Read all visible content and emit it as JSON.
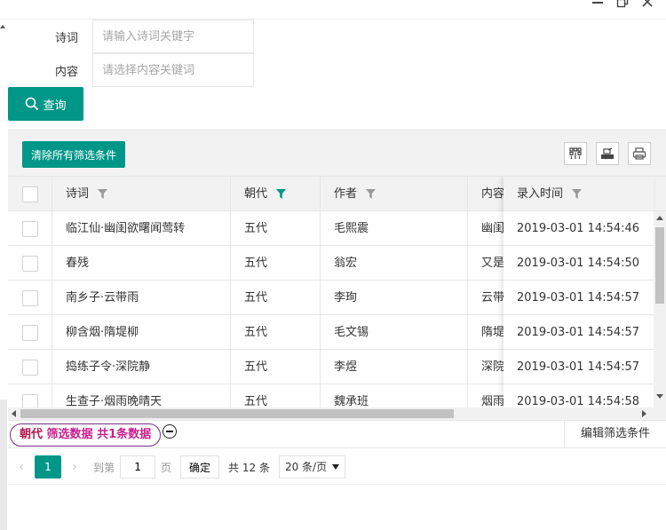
{
  "form": {
    "poem_label": "诗词",
    "poem_placeholder": "请输入诗词关键字",
    "content_label": "内容",
    "content_placeholder": "请选择内容关键词",
    "query_label": "查询"
  },
  "toolbar": {
    "clear_label": "清除所有筛选条件"
  },
  "columns": {
    "poem": "诗词",
    "dynasty": "朝代",
    "author": "作者",
    "content": "内容",
    "time": "录入时间"
  },
  "rows": [
    {
      "poem": "临江仙·幽闺欲曙闻莺转",
      "dynasty": "五代",
      "author": "毛熙震",
      "content": "幽闺",
      "time": "2019-03-01 14:54:46"
    },
    {
      "poem": "春残",
      "dynasty": "五代",
      "author": "翁宏",
      "content": "又是",
      "time": "2019-03-01 14:54:50"
    },
    {
      "poem": "南乡子·云带雨",
      "dynasty": "五代",
      "author": "李珣",
      "content": "云带",
      "time": "2019-03-01 14:54:57"
    },
    {
      "poem": "柳含烟·隋堤柳",
      "dynasty": "五代",
      "author": "毛文锡",
      "content": "隋堤",
      "time": "2019-03-01 14:54:57"
    },
    {
      "poem": "捣练子令·深院静",
      "dynasty": "五代",
      "author": "李煜",
      "content": "深院",
      "time": "2019-03-01 14:54:57"
    },
    {
      "poem": "生查子·烟雨晚晴天",
      "dynasty": "五代",
      "author": "魏承班",
      "content": "烟雨",
      "time": "2019-03-01 14:54:58"
    }
  ],
  "filterbar": {
    "field": "朝代",
    "summary": " 筛选数据 共1条数据",
    "edit_label": "编辑筛选条件"
  },
  "pager": {
    "current_page": "1",
    "goto_label": "到第",
    "goto_value": "1",
    "page_unit": "页",
    "confirm_label": "确定",
    "total": "共 12 条",
    "page_size": "20 条/页"
  },
  "colors": {
    "primary": "#009688",
    "filter_active": "#009688",
    "tag_text": "#c71f8f"
  }
}
